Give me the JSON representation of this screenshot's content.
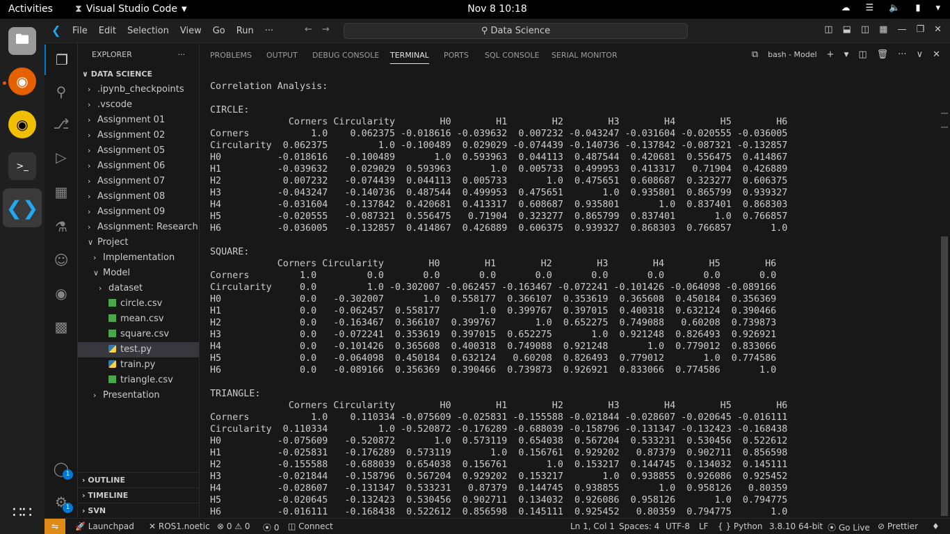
{
  "topbar": {
    "activities": "Activities",
    "app_name": "Visual Studio Code",
    "clock": "Nov 8  10:18"
  },
  "titlebar": {
    "menus": [
      "File",
      "Edit",
      "Selection",
      "View",
      "Go",
      "Run",
      "···"
    ],
    "search": "Data Science"
  },
  "sidebar": {
    "title": "EXPLORER",
    "more": "···",
    "folder": "DATA SCIENCE",
    "items": [
      {
        "label": ".ipynb_checkpoints",
        "chev": "›",
        "icon": "",
        "depth": 1
      },
      {
        "label": ".vscode",
        "chev": "›",
        "icon": "",
        "depth": 1
      },
      {
        "label": "Assignment 01",
        "chev": "›",
        "icon": "",
        "depth": 1
      },
      {
        "label": "Assignment 02",
        "chev": "›",
        "icon": "",
        "depth": 1
      },
      {
        "label": "Assignment 05",
        "chev": "›",
        "icon": "",
        "depth": 1
      },
      {
        "label": "Assignment 06",
        "chev": "›",
        "icon": "",
        "depth": 1
      },
      {
        "label": "Assignment 07",
        "chev": "›",
        "icon": "",
        "depth": 1
      },
      {
        "label": "Assignment 08",
        "chev": "›",
        "icon": "",
        "depth": 1
      },
      {
        "label": "Assignment 09",
        "chev": "›",
        "icon": "",
        "depth": 1
      },
      {
        "label": "Assignment: Research",
        "chev": "›",
        "icon": "",
        "depth": 1
      },
      {
        "label": "Project",
        "chev": "∨",
        "icon": "",
        "depth": 1
      },
      {
        "label": "Implementation",
        "chev": "›",
        "icon": "",
        "depth": 2
      },
      {
        "label": "Model",
        "chev": "∨",
        "icon": "",
        "depth": 2
      },
      {
        "label": "dataset",
        "chev": "›",
        "icon": "",
        "depth": 3
      },
      {
        "label": "circle.csv",
        "chev": "",
        "icon": "csv",
        "depth": 3
      },
      {
        "label": "mean.csv",
        "chev": "",
        "icon": "csv",
        "depth": 3
      },
      {
        "label": "square.csv",
        "chev": "",
        "icon": "csv",
        "depth": 3
      },
      {
        "label": "test.py",
        "chev": "",
        "icon": "py",
        "depth": 3,
        "selected": true
      },
      {
        "label": "train.py",
        "chev": "",
        "icon": "py",
        "depth": 3
      },
      {
        "label": "triangle.csv",
        "chev": "",
        "icon": "csv",
        "depth": 3
      },
      {
        "label": "Presentation",
        "chev": "›",
        "icon": "",
        "depth": 2
      }
    ],
    "outline": "OUTLINE",
    "timeline": "TIMELINE",
    "svn": "SVN"
  },
  "panel": {
    "tabs": [
      "PROBLEMS",
      "OUTPUT",
      "DEBUG CONSOLE",
      "TERMINAL",
      "PORTS",
      "SQL CONSOLE",
      "SERIAL MONITOR"
    ],
    "active_tab": "TERMINAL",
    "terminal_name": "bash - Model"
  },
  "terminal": {
    "lines": [
      "Correlation Analysis:",
      "",
      "CIRCLE:",
      "              Corners Circularity        H0        H1        H2        H3        H4        H5        H6",
      "Corners           1.0    0.062375 -0.018616 -0.039632  0.007232 -0.043247 -0.031604 -0.020555 -0.036005",
      "Circularity  0.062375         1.0 -0.100489  0.029029 -0.074439 -0.140736 -0.137842 -0.087321 -0.132857",
      "H0          -0.018616   -0.100489       1.0  0.593963  0.044113  0.487544  0.420681  0.556475  0.414867",
      "H1          -0.039632    0.029029  0.593963       1.0  0.005733  0.499953  0.413317   0.71904  0.426889",
      "H2           0.007232   -0.074439  0.044113  0.005733       1.0  0.475651  0.608687  0.323277  0.606375",
      "H3          -0.043247   -0.140736  0.487544  0.499953  0.475651       1.0  0.935801  0.865799  0.939327",
      "H4          -0.031604   -0.137842  0.420681  0.413317  0.608687  0.935801       1.0  0.837401  0.868303",
      "H5          -0.020555   -0.087321  0.556475   0.71904  0.323277  0.865799  0.837401       1.0  0.766857",
      "H6          -0.036005   -0.132857  0.414867  0.426889  0.606375  0.939327  0.868303  0.766857       1.0",
      "",
      "SQUARE:",
      "            Corners Circularity        H0        H1        H2        H3        H4        H5        H6",
      "Corners         1.0         0.0       0.0       0.0       0.0       0.0       0.0       0.0       0.0",
      "Circularity     0.0         1.0 -0.302007 -0.062457 -0.163467 -0.072241 -0.101426 -0.064098 -0.089166",
      "H0              0.0   -0.302007       1.0  0.558177  0.366107  0.353619  0.365608  0.450184  0.356369",
      "H1              0.0   -0.062457  0.558177       1.0  0.399767  0.397015  0.400318  0.632124  0.390466",
      "H2              0.0   -0.163467  0.366107  0.399767       1.0  0.652275  0.749088   0.60208  0.739873",
      "H3              0.0   -0.072241  0.353619  0.397015  0.652275       1.0  0.921248  0.826493  0.926921",
      "H4              0.0   -0.101426  0.365608  0.400318  0.749088  0.921248       1.0  0.779012  0.833066",
      "H5              0.0   -0.064098  0.450184  0.632124   0.60208  0.826493  0.779012       1.0  0.774586",
      "H6              0.0   -0.089166  0.356369  0.390466  0.739873  0.926921  0.833066  0.774586       1.0",
      "",
      "TRIANGLE:",
      "              Corners Circularity        H0        H1        H2        H3        H4        H5        H6",
      "Corners           1.0    0.110334 -0.075609 -0.025831 -0.155588 -0.021844 -0.028607 -0.020645 -0.016111",
      "Circularity  0.110334         1.0 -0.520872 -0.176289 -0.688039 -0.158796 -0.131347 -0.132423 -0.168438",
      "H0          -0.075609   -0.520872       1.0  0.573119  0.654038  0.567204  0.533231  0.530456  0.522612",
      "H1          -0.025831   -0.176289  0.573119       1.0  0.156761  0.929202   0.87379  0.902711  0.856598",
      "H2          -0.155588   -0.688039  0.654038  0.156761       1.0  0.153217  0.144745  0.134032  0.145111",
      "H3          -0.021844   -0.158796  0.567204  0.929202  0.153217       1.0  0.938855  0.926086  0.925452",
      "H4          -0.028607   -0.131347  0.533231   0.87379  0.144745  0.938855       1.0  0.958126   0.80359",
      "H5          -0.020645   -0.132423  0.530456  0.902711  0.134032  0.926086  0.958126       1.0  0.794775",
      "H6          -0.016111   -0.168438  0.522612  0.856598  0.145111  0.925452   0.80359  0.794775       1.0"
    ]
  },
  "statusbar": {
    "launchpad": "Launchpad",
    "ros": "ROS1.noetic",
    "errors": "0",
    "warnings": "0",
    "ports": "0",
    "connect": "Connect",
    "position": "Ln 1, Col 1",
    "spaces": "Spaces: 4",
    "encoding": "UTF-8",
    "eol": "LF",
    "language": "Python",
    "interpreter": "3.8.10 64-bit",
    "golive": "Go Live",
    "prettier": "Prettier"
  },
  "activity_badges": {
    "accounts": "1",
    "settings": "1"
  },
  "colors": {
    "accent": "#0078d4",
    "remote": "#e08a17",
    "selection": "#37373d"
  }
}
